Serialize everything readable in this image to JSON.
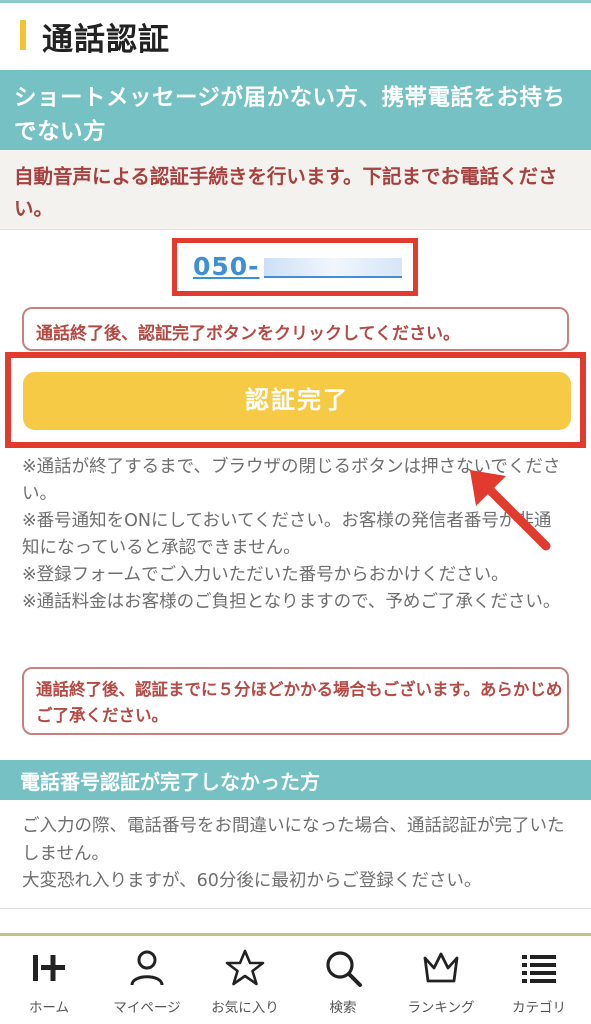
{
  "page": {
    "title": "通話認証",
    "section_header": "ショートメッセージが届かない方、携帯電話をお持ちでない方",
    "notice": "自動音声による認証手続きを行います。下記までお電話ください。",
    "phone_prefix": "050-",
    "instruction": "通話終了後、認証完了ボタンをクリックしてください。",
    "confirm_button": "認証完了",
    "notes": [
      "※通話が終了するまで、ブラウザの閉じるボタンは押さないでください。",
      "※番号通知をONにしておいてください。お客様の発信者番号が非通知になっていると承認できません。",
      "※登録フォームでご入力いただいた番号からおかけください。",
      "※通話料金はお客様のご負担となりますので、予めご了承ください。"
    ],
    "wait_notice": "通話終了後、認証までに５分ほどかかる場合もございます。あらかじめご了承ください。",
    "subsection_header": "電話番号認証が完了しなかった方",
    "help_text": [
      "ご入力の際、電話番号をお間違いになった場合、通話認証が完了いたしません。",
      "大変恐れ入りますが、60分後に最初からご登録ください。"
    ]
  },
  "tabbar": {
    "items": [
      {
        "label": "ホーム",
        "icon": "home-logo-icon"
      },
      {
        "label": "マイページ",
        "icon": "person-icon"
      },
      {
        "label": "お気に入り",
        "icon": "star-icon"
      },
      {
        "label": "検索",
        "icon": "search-icon"
      },
      {
        "label": "ランキング",
        "icon": "crown-icon"
      },
      {
        "label": "カテゴリ",
        "icon": "list-icon"
      }
    ]
  },
  "colors": {
    "teal": "#76c1c3",
    "accent_yellow": "#f6ca45",
    "highlight_red": "#e23b2e",
    "notice_red": "#a7413f",
    "link_blue": "#3f8fd6"
  }
}
